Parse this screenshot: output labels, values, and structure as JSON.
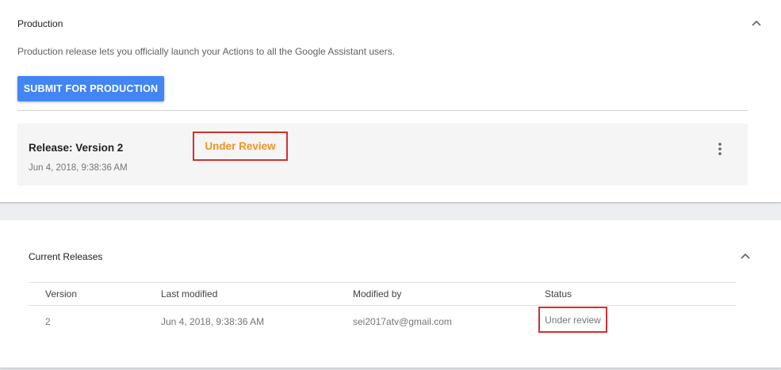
{
  "production": {
    "title": "Production",
    "description": "Production release lets you officially launch your Actions to all the Google Assistant users.",
    "submit_label": "SUBMIT FOR PRODUCTION",
    "release": {
      "title": "Release: Version 2",
      "date": "Jun 4, 2018, 9:38:36 AM",
      "status": "Under Review"
    }
  },
  "current_releases": {
    "title": "Current Releases",
    "columns": [
      "Version",
      "Last modified",
      "Modified by",
      "Status"
    ],
    "rows": [
      {
        "version": "2",
        "last_modified": "Jun 4, 2018, 9:38:36 AM",
        "modified_by": "sei2017atv@gmail.com",
        "status": "Under review"
      }
    ]
  },
  "colors": {
    "accent": "#4285f4",
    "status_orange": "#f29423",
    "highlight_red": "#d32f2f"
  },
  "icons": [
    "chevron-up-icon",
    "more-vert-icon"
  ]
}
